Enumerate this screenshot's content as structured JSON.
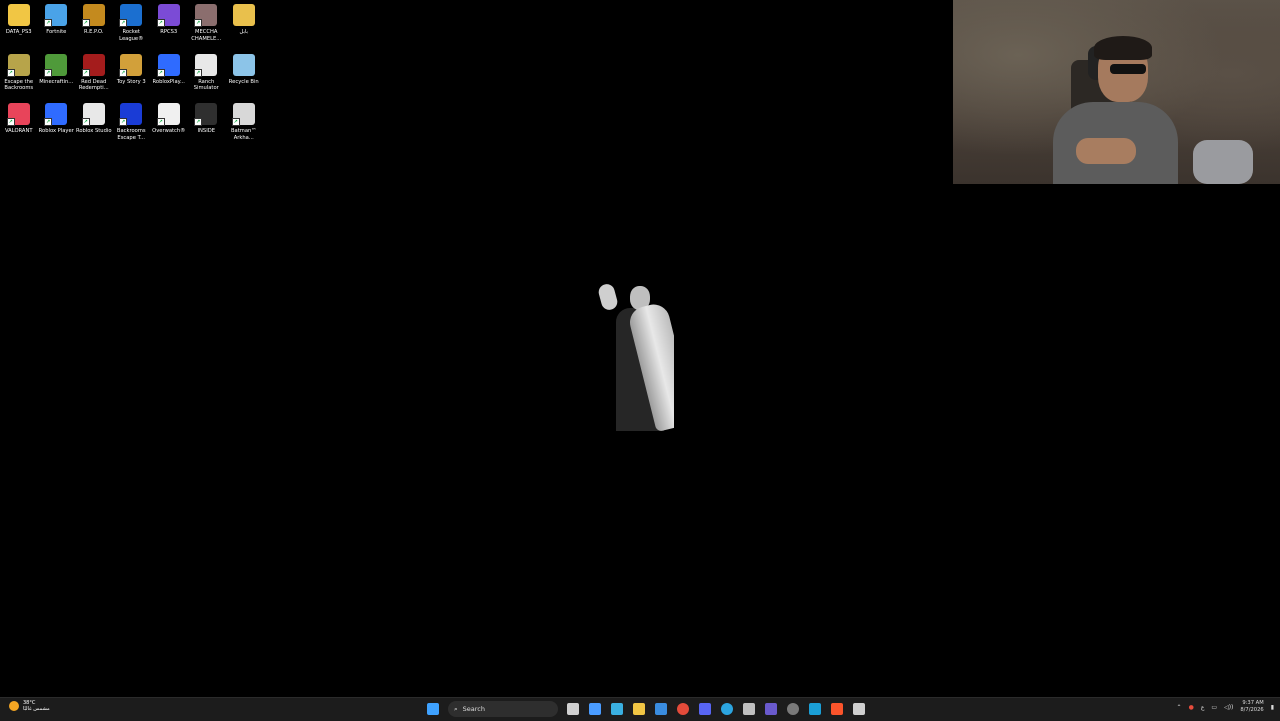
{
  "desktop": {
    "icons": [
      {
        "label": "DATA_PS3",
        "icon": "folder-icon",
        "color": "#f1c644",
        "shortcut": false
      },
      {
        "label": "Fortnite",
        "icon": "fortnite-icon",
        "color": "#4aa3e8",
        "shortcut": true
      },
      {
        "label": "R.E.P.O.",
        "icon": "repo-icon",
        "color": "#c48a1e",
        "shortcut": true
      },
      {
        "label": "Rocket League®",
        "icon": "rocket-league-icon",
        "color": "#1b6fd0",
        "shortcut": true
      },
      {
        "label": "RPCS3",
        "icon": "rpcs3-icon",
        "color": "#7b4bd6",
        "shortcut": true
      },
      {
        "label": "MECCHA CHAMELE...",
        "icon": "meccha-chameleon-icon",
        "color": "#8b6e6e",
        "shortcut": true
      },
      {
        "label": "بابل",
        "icon": "folder-icon",
        "color": "#e9c04c",
        "shortcut": false
      },
      {
        "label": "Escape the Backrooms",
        "icon": "escape-backrooms-icon",
        "color": "#b7a44a",
        "shortcut": true
      },
      {
        "label": "Minecraftin...",
        "icon": "minecraft-icon",
        "color": "#4f9a3a",
        "shortcut": true
      },
      {
        "label": "Red Dead Redempti...",
        "icon": "red-dead-icon",
        "color": "#a41c1c",
        "shortcut": true
      },
      {
        "label": "Toy Story 3",
        "icon": "toy-story-icon",
        "color": "#d2a03a",
        "shortcut": true
      },
      {
        "label": "RobloxPlay...",
        "icon": "roblox-player-icon",
        "color": "#2f6bff",
        "shortcut": true
      },
      {
        "label": "Ranch Simulator",
        "icon": "ranch-simulator-icon",
        "color": "#e8e8e8",
        "shortcut": true
      },
      {
        "label": "Recycle Bin",
        "icon": "recycle-bin-icon",
        "color": "#8cc4e8",
        "shortcut": false
      },
      {
        "label": "VALORANT",
        "icon": "valorant-icon",
        "color": "#e8445a",
        "shortcut": true
      },
      {
        "label": "Roblox Player",
        "icon": "roblox-player-icon",
        "color": "#2f6bff",
        "shortcut": true
      },
      {
        "label": "Roblox Studio",
        "icon": "roblox-studio-icon",
        "color": "#e8e8e8",
        "shortcut": true
      },
      {
        "label": "Backrooms Escape T...",
        "icon": "backrooms-escape-icon",
        "color": "#1a3cd6",
        "shortcut": true
      },
      {
        "label": "Overwatch®",
        "icon": "overwatch-icon",
        "color": "#f0f0f0",
        "shortcut": true
      },
      {
        "label": "INSIDE",
        "icon": "inside-icon",
        "color": "#2f2f2f",
        "shortcut": true
      },
      {
        "label": "Batman™ Arkha...",
        "icon": "batman-icon",
        "color": "#d8d8d8",
        "shortcut": true
      }
    ]
  },
  "taskbar": {
    "weather": {
      "temp": "38°C",
      "desc": "مشمس غالبًا"
    },
    "search_label": "Search",
    "apps": [
      {
        "name": "start-button",
        "icon": "windows-start-icon",
        "color": "#3fa2ff"
      },
      {
        "name": "task-view-button",
        "icon": "task-view-icon",
        "color": "#d0d0d0"
      },
      {
        "name": "widgets-button",
        "icon": "widgets-icon",
        "color": "#4a9cff"
      },
      {
        "name": "copilot-button",
        "icon": "copilot-icon",
        "color": "#3ab0e0"
      },
      {
        "name": "file-explorer-button",
        "icon": "folder-icon",
        "color": "#f1c644"
      },
      {
        "name": "store-button",
        "icon": "store-icon",
        "color": "#3a8de0"
      },
      {
        "name": "chrome-button",
        "icon": "chrome-icon",
        "color": "#e44b3a"
      },
      {
        "name": "discord-button",
        "icon": "discord-icon",
        "color": "#5865f2"
      },
      {
        "name": "telegram-button",
        "icon": "telegram-icon",
        "color": "#2ca5e0"
      },
      {
        "name": "app-s-button",
        "icon": "s-app-icon",
        "color": "#c0c0c0"
      },
      {
        "name": "app-diamond-button",
        "icon": "diamond-icon",
        "color": "#6a5acd"
      },
      {
        "name": "app-record-button",
        "icon": "record-icon",
        "color": "#7a7a7a"
      },
      {
        "name": "steam-button",
        "icon": "steam-icon",
        "color": "#1b9fd6"
      },
      {
        "name": "brave-button",
        "icon": "brave-icon",
        "color": "#fb542b"
      },
      {
        "name": "settings-button",
        "icon": "gear-icon",
        "color": "#cfcfcf"
      }
    ],
    "tray": {
      "language": "ع",
      "time": "9:37 AM",
      "date": "8/7/2026"
    }
  }
}
